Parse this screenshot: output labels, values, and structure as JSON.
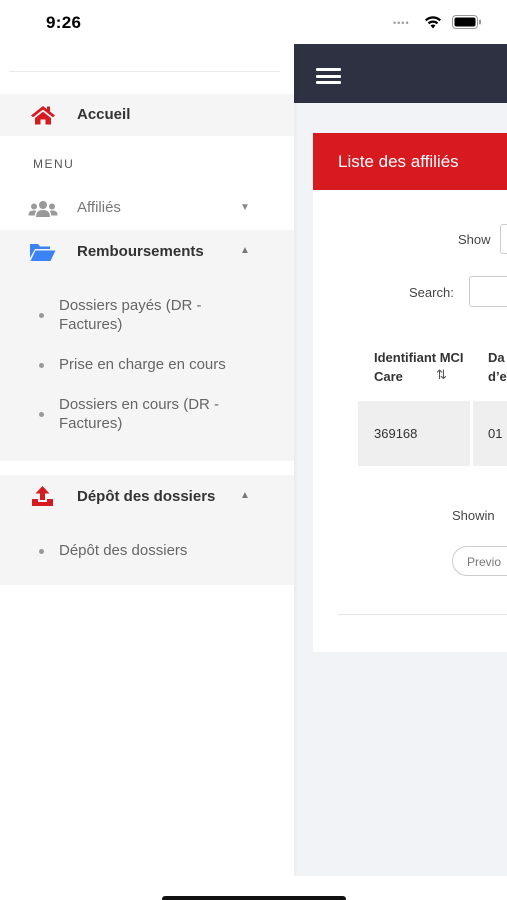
{
  "status_bar": {
    "time": "9:26"
  },
  "colors": {
    "brand_red": "#d71920",
    "topbar": "#2e3141",
    "folder_blue": "#3b82f6"
  },
  "drawer": {
    "home": {
      "label": "Accueil",
      "icon": "home-icon"
    },
    "menu_heading": "MENU",
    "affilies": {
      "label": "Affiliés",
      "icon": "users-icon"
    },
    "remboursements": {
      "label": "Remboursements",
      "icon": "folder-open-icon",
      "items": [
        {
          "label": "Dossiers payés (DR - Factures)"
        },
        {
          "label": "Prise en charge en cours"
        },
        {
          "label": "Dossiers en cours (DR - Factures)"
        }
      ]
    },
    "depot": {
      "label": "Dépôt des dossiers",
      "icon": "upload-icon",
      "items": [
        {
          "label": "Dépôt des dossiers"
        }
      ]
    }
  },
  "main": {
    "card_title": "Liste des affiliés",
    "show_label": "Show",
    "search_label": "Search:",
    "table": {
      "headers": [
        "Identifiant MCI Care",
        "Da d’e"
      ],
      "rows": [
        [
          "369168",
          "01"
        ]
      ]
    },
    "showing_text": "Showin",
    "previous_label": "Previo"
  }
}
